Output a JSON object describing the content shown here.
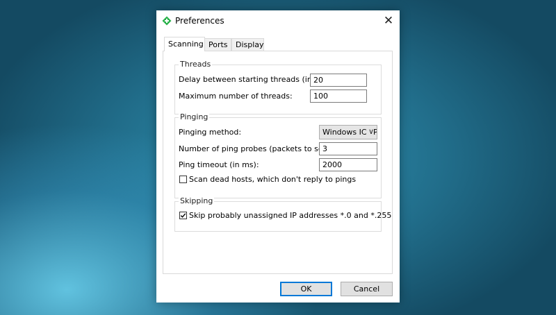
{
  "window": {
    "title": "Preferences"
  },
  "tabs": [
    {
      "label": "Scanning"
    },
    {
      "label": "Ports"
    },
    {
      "label": "Display"
    }
  ],
  "threads": {
    "title": "Threads",
    "delay_label": "Delay between starting threads (in ms):",
    "delay_value": "20",
    "max_label": "Maximum number of threads:",
    "max_value": "100"
  },
  "pinging": {
    "title": "Pinging",
    "method_label": "Pinging method:",
    "method_value": "Windows ICMP",
    "probes_label": "Number of ping probes (packets to send):",
    "probes_value": "3",
    "timeout_label": "Ping timeout (in ms):",
    "timeout_value": "2000",
    "scan_dead_label": "Scan dead hosts, which don't reply to pings",
    "scan_dead_checked": false
  },
  "skipping": {
    "title": "Skipping",
    "skip_label": "Skip probably unassigned IP addresses *.0 and *.255",
    "skip_checked": true
  },
  "buttons": {
    "ok": "OK",
    "cancel": "Cancel"
  },
  "colors": {
    "accent": "#0078d7",
    "icon_green": "#2bb24c"
  }
}
